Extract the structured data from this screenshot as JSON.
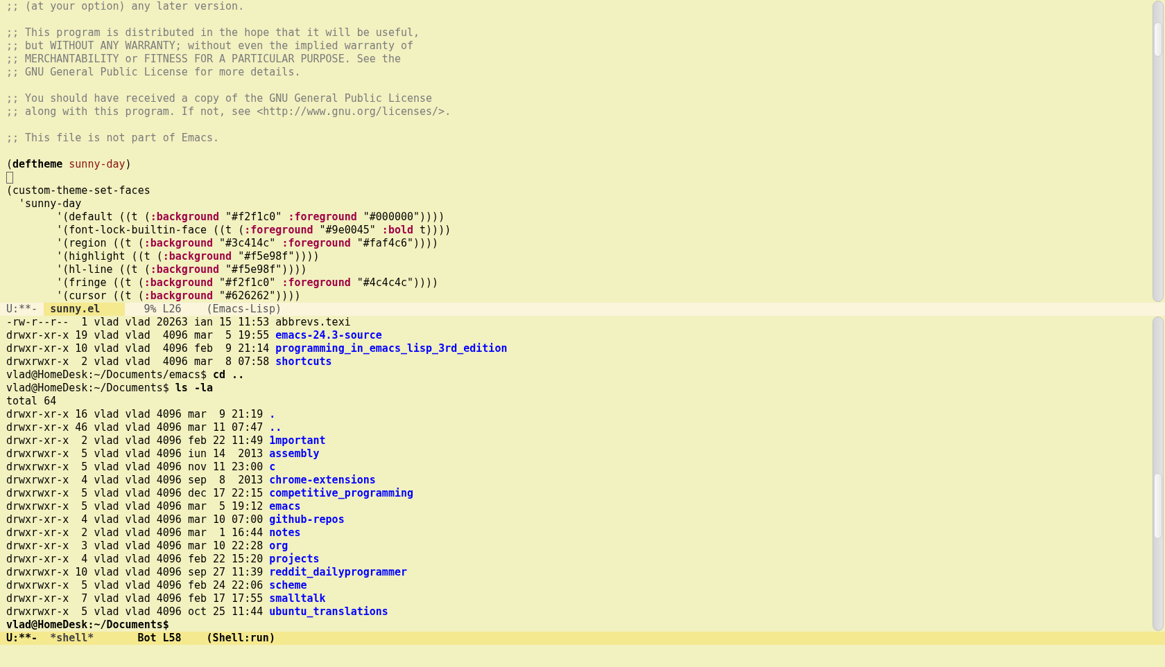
{
  "windows": [
    {
      "kind": "editor",
      "lines": [
        {
          "segments": [
            {
              "kind": "comment",
              "text": ";; (at your option) any later version."
            }
          ]
        },
        {
          "kind": "blank"
        },
        {
          "segments": [
            {
              "kind": "comment",
              "text": ";; This program is distributed in the hope that it will be useful,"
            }
          ]
        },
        {
          "segments": [
            {
              "kind": "comment",
              "text": ";; but WITHOUT ANY WARRANTY; without even the implied warranty of"
            }
          ]
        },
        {
          "segments": [
            {
              "kind": "comment",
              "text": ";; MERCHANTABILITY or FITNESS FOR A PARTICULAR PURPOSE. See the"
            }
          ]
        },
        {
          "segments": [
            {
              "kind": "comment",
              "text": ";; GNU General Public License for more details."
            }
          ]
        },
        {
          "kind": "blank"
        },
        {
          "segments": [
            {
              "kind": "comment",
              "text": ";; You should have received a copy of the GNU General Public License"
            }
          ]
        },
        {
          "segments": [
            {
              "kind": "comment",
              "text": ";; along with this program. If not, see <http://www.gnu.org/licenses/>."
            }
          ]
        },
        {
          "kind": "blank"
        },
        {
          "segments": [
            {
              "kind": "comment",
              "text": ";; This file is not part of Emacs."
            }
          ]
        },
        {
          "kind": "blank"
        },
        {
          "segments": [
            {
              "kind": "plain",
              "text": "("
            },
            {
              "kind": "keyword",
              "text": "deftheme"
            },
            {
              "kind": "name",
              "text": " sunny-day"
            },
            {
              "kind": "plain",
              "text": ")"
            }
          ]
        },
        {
          "kind": "cursor"
        },
        {
          "segments": [
            {
              "kind": "plain",
              "text": "(custom-theme-set-faces"
            }
          ]
        },
        {
          "segments": [
            {
              "kind": "plain",
              "text": "  'sunny-day"
            }
          ]
        },
        {
          "segments": [
            {
              "kind": "plain",
              "text": "        '(default ((t ("
            },
            {
              "kind": "builtin",
              "text": ":background"
            },
            {
              "kind": "plain",
              "text": " \"#f2f1c0\" "
            },
            {
              "kind": "builtin",
              "text": ":foreground"
            },
            {
              "kind": "plain",
              "text": " \"#000000\"))))"
            }
          ]
        },
        {
          "segments": [
            {
              "kind": "plain",
              "text": "        '(font-lock-builtin-face ((t ("
            },
            {
              "kind": "builtin",
              "text": ":foreground"
            },
            {
              "kind": "plain",
              "text": " \"#9e0045\" "
            },
            {
              "kind": "builtin",
              "text": ":bold"
            },
            {
              "kind": "plain",
              "text": " t))))"
            }
          ]
        },
        {
          "segments": [
            {
              "kind": "plain",
              "text": "        '(region ((t ("
            },
            {
              "kind": "builtin",
              "text": ":background"
            },
            {
              "kind": "plain",
              "text": " \"#3c414c\" "
            },
            {
              "kind": "builtin",
              "text": ":foreground"
            },
            {
              "kind": "plain",
              "text": " \"#faf4c6\"))))"
            }
          ]
        },
        {
          "segments": [
            {
              "kind": "plain",
              "text": "        '(highlight ((t ("
            },
            {
              "kind": "builtin",
              "text": ":background"
            },
            {
              "kind": "plain",
              "text": " \"#f5e98f\"))))"
            }
          ]
        },
        {
          "segments": [
            {
              "kind": "plain",
              "text": "        '(hl-line ((t ("
            },
            {
              "kind": "builtin",
              "text": ":background"
            },
            {
              "kind": "plain",
              "text": " \"#f5e98f\"))))"
            }
          ]
        },
        {
          "segments": [
            {
              "kind": "plain",
              "text": "        '(fringe ((t ("
            },
            {
              "kind": "builtin",
              "text": ":background"
            },
            {
              "kind": "plain",
              "text": " \"#f2f1c0\" "
            },
            {
              "kind": "builtin",
              "text": ":foreground"
            },
            {
              "kind": "plain",
              "text": " \"#4c4c4c\"))))"
            }
          ]
        },
        {
          "segments": [
            {
              "kind": "plain",
              "text": "        '(cursor ((t ("
            },
            {
              "kind": "builtin",
              "text": ":background"
            },
            {
              "kind": "plain",
              "text": " \"#626262\"))))"
            }
          ]
        }
      ],
      "mode_line": {
        "active": false,
        "status": "U:**-",
        "buffer": "sunny.el",
        "position": "9% L26",
        "mode": "(Emacs-Lisp)"
      }
    },
    {
      "kind": "shell",
      "lines": [
        {
          "segments": [
            {
              "kind": "plain",
              "text": "-rw-r--r--  1 vlad vlad 20263 ian 15 11:53 abbrevs.texi"
            }
          ]
        },
        {
          "segments": [
            {
              "kind": "plain",
              "text": "drwxr-xr-x 19 vlad vlad  4096 mar  5 19:55 "
            },
            {
              "kind": "directory",
              "text": "emacs-24.3-source"
            }
          ]
        },
        {
          "segments": [
            {
              "kind": "plain",
              "text": "drwxr-xr-x 10 vlad vlad  4096 feb  9 21:14 "
            },
            {
              "kind": "directory",
              "text": "programming_in_emacs_lisp_3rd_edition"
            }
          ]
        },
        {
          "segments": [
            {
              "kind": "plain",
              "text": "drwxrwxr-x  2 vlad vlad  4096 mar  8 07:58 "
            },
            {
              "kind": "directory",
              "text": "shortcuts"
            }
          ]
        },
        {
          "segments": [
            {
              "kind": "plain",
              "text": "vlad@HomeDesk:~/Documents/emacs$ "
            },
            {
              "kind": "input",
              "text": "cd .."
            }
          ]
        },
        {
          "segments": [
            {
              "kind": "plain",
              "text": "vlad@HomeDesk:~/Documents$ "
            },
            {
              "kind": "input",
              "text": "ls -la"
            }
          ]
        },
        {
          "segments": [
            {
              "kind": "plain",
              "text": "total 64"
            }
          ]
        },
        {
          "segments": [
            {
              "kind": "plain",
              "text": "drwxr-xr-x 16 vlad vlad 4096 mar  9 21:19 "
            },
            {
              "kind": "directory",
              "text": "."
            }
          ]
        },
        {
          "segments": [
            {
              "kind": "plain",
              "text": "drwxr-xr-x 46 vlad vlad 4096 mar 11 07:47 "
            },
            {
              "kind": "directory",
              "text": ".."
            }
          ]
        },
        {
          "segments": [
            {
              "kind": "plain",
              "text": "drwxr-xr-x  2 vlad vlad 4096 feb 22 11:49 "
            },
            {
              "kind": "directory",
              "text": "1mportant"
            }
          ]
        },
        {
          "segments": [
            {
              "kind": "plain",
              "text": "drwxrwxr-x  5 vlad vlad 4096 iun 14  2013 "
            },
            {
              "kind": "directory",
              "text": "assembly"
            }
          ]
        },
        {
          "segments": [
            {
              "kind": "plain",
              "text": "drwxrwxr-x  5 vlad vlad 4096 nov 11 23:00 "
            },
            {
              "kind": "directory",
              "text": "c"
            }
          ]
        },
        {
          "segments": [
            {
              "kind": "plain",
              "text": "drwxrwxr-x  4 vlad vlad 4096 sep  8  2013 "
            },
            {
              "kind": "directory",
              "text": "chrome-extensions"
            }
          ]
        },
        {
          "segments": [
            {
              "kind": "plain",
              "text": "drwxrwxr-x  5 vlad vlad 4096 dec 17 22:15 "
            },
            {
              "kind": "directory",
              "text": "competitive_programming"
            }
          ]
        },
        {
          "segments": [
            {
              "kind": "plain",
              "text": "drwxrwxr-x  5 vlad vlad 4096 mar  5 19:12 "
            },
            {
              "kind": "directory",
              "text": "emacs"
            }
          ]
        },
        {
          "segments": [
            {
              "kind": "plain",
              "text": "drwxr-xr-x  4 vlad vlad 4096 mar 10 07:00 "
            },
            {
              "kind": "directory",
              "text": "github-repos"
            }
          ]
        },
        {
          "segments": [
            {
              "kind": "plain",
              "text": "drwxr-xr-x  2 vlad vlad 4096 mar  1 16:44 "
            },
            {
              "kind": "directory",
              "text": "notes"
            }
          ]
        },
        {
          "segments": [
            {
              "kind": "plain",
              "text": "drwxr-xr-x  3 vlad vlad 4096 mar 10 22:28 "
            },
            {
              "kind": "directory",
              "text": "org"
            }
          ]
        },
        {
          "segments": [
            {
              "kind": "plain",
              "text": "drwxr-xr-x  4 vlad vlad 4096 feb 22 15:20 "
            },
            {
              "kind": "directory",
              "text": "projects"
            }
          ]
        },
        {
          "segments": [
            {
              "kind": "plain",
              "text": "drwxrwxr-x 10 vlad vlad 4096 sep 27 11:39 "
            },
            {
              "kind": "directory",
              "text": "reddit_dailyprogrammer"
            }
          ]
        },
        {
          "segments": [
            {
              "kind": "plain",
              "text": "drwxrwxr-x  5 vlad vlad 4096 feb 24 22:06 "
            },
            {
              "kind": "directory",
              "text": "scheme"
            }
          ]
        },
        {
          "segments": [
            {
              "kind": "plain",
              "text": "drwxr-xr-x  7 vlad vlad 4096 feb 17 17:55 "
            },
            {
              "kind": "directory",
              "text": "smalltalk"
            }
          ]
        },
        {
          "segments": [
            {
              "kind": "plain",
              "text": "drwxrwxr-x  5 vlad vlad 4096 oct 25 11:44 "
            },
            {
              "kind": "directory",
              "text": "ubuntu_translations"
            }
          ]
        },
        {
          "segments": [
            {
              "kind": "input",
              "text": "vlad@HomeDesk:~/Documents$"
            }
          ]
        }
      ],
      "mode_line": {
        "active": true,
        "status": "U:**-",
        "buffer": "*shell*",
        "position": "Bot L58",
        "mode": "(Shell:run)"
      }
    }
  ]
}
